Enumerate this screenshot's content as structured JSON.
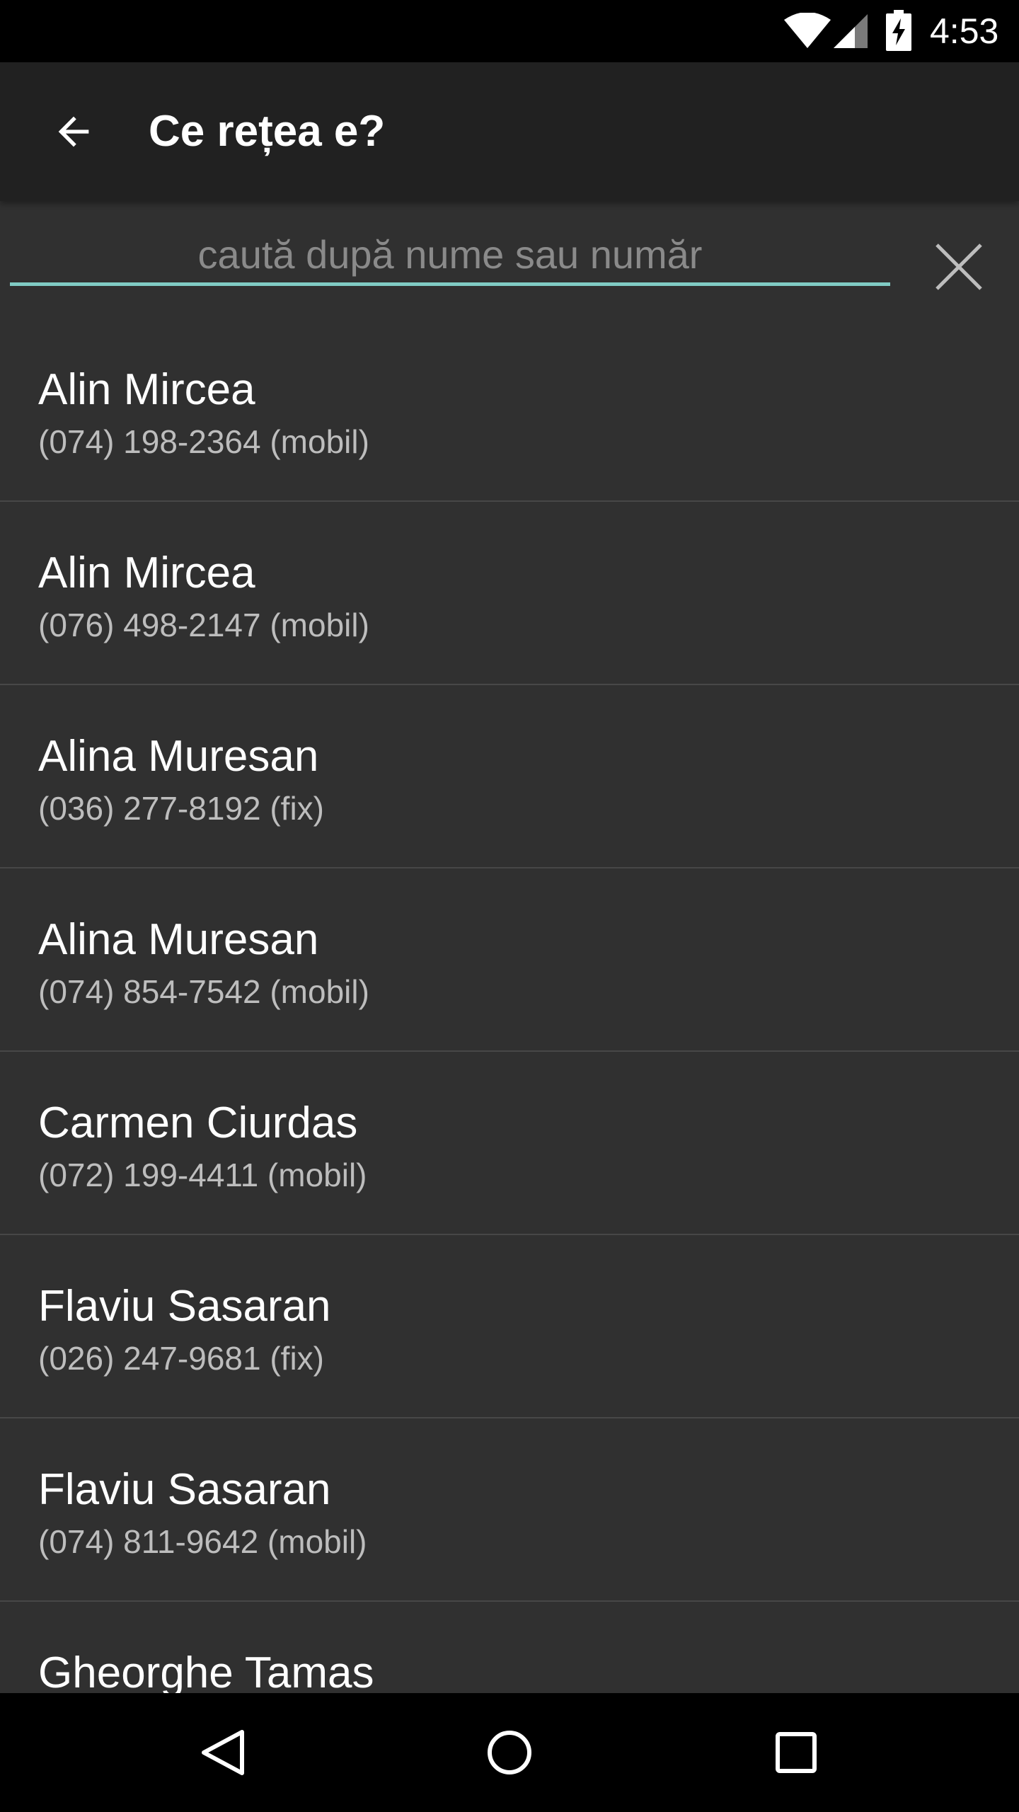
{
  "status_bar": {
    "time": "4:53",
    "icons": [
      "wifi-icon",
      "signal-icon",
      "battery-charging-icon"
    ]
  },
  "app_bar": {
    "back_icon": "arrow-left-icon",
    "title": "Ce rețea e?"
  },
  "search": {
    "value": "",
    "placeholder": "caută după nume sau număr",
    "clear_icon": "close-icon",
    "accent_color": "#80cbc4"
  },
  "contacts": [
    {
      "name": "Alin Mircea",
      "phone": "(074) 198-2364 (mobil)"
    },
    {
      "name": "Alin Mircea",
      "phone": "(076) 498-2147 (mobil)"
    },
    {
      "name": "Alina Muresan",
      "phone": "(036) 277-8192 (fix)"
    },
    {
      "name": "Alina Muresan",
      "phone": "(074) 854-7542 (mobil)"
    },
    {
      "name": "Carmen Ciurdas",
      "phone": "(072) 199-4411 (mobil)"
    },
    {
      "name": "Flaviu Sasaran",
      "phone": "(026) 247-9681 (fix)"
    },
    {
      "name": "Flaviu Sasaran",
      "phone": "(074) 811-9642 (mobil)"
    },
    {
      "name": "Gheorghe Tamas",
      "phone": ""
    }
  ],
  "nav_bar": {
    "buttons": [
      "nav-back-icon",
      "nav-home-icon",
      "nav-recents-icon"
    ]
  },
  "colors": {
    "background": "#303030",
    "app_bar": "#212121",
    "divider": "#474747",
    "secondary_text": "#bdbdbd"
  }
}
